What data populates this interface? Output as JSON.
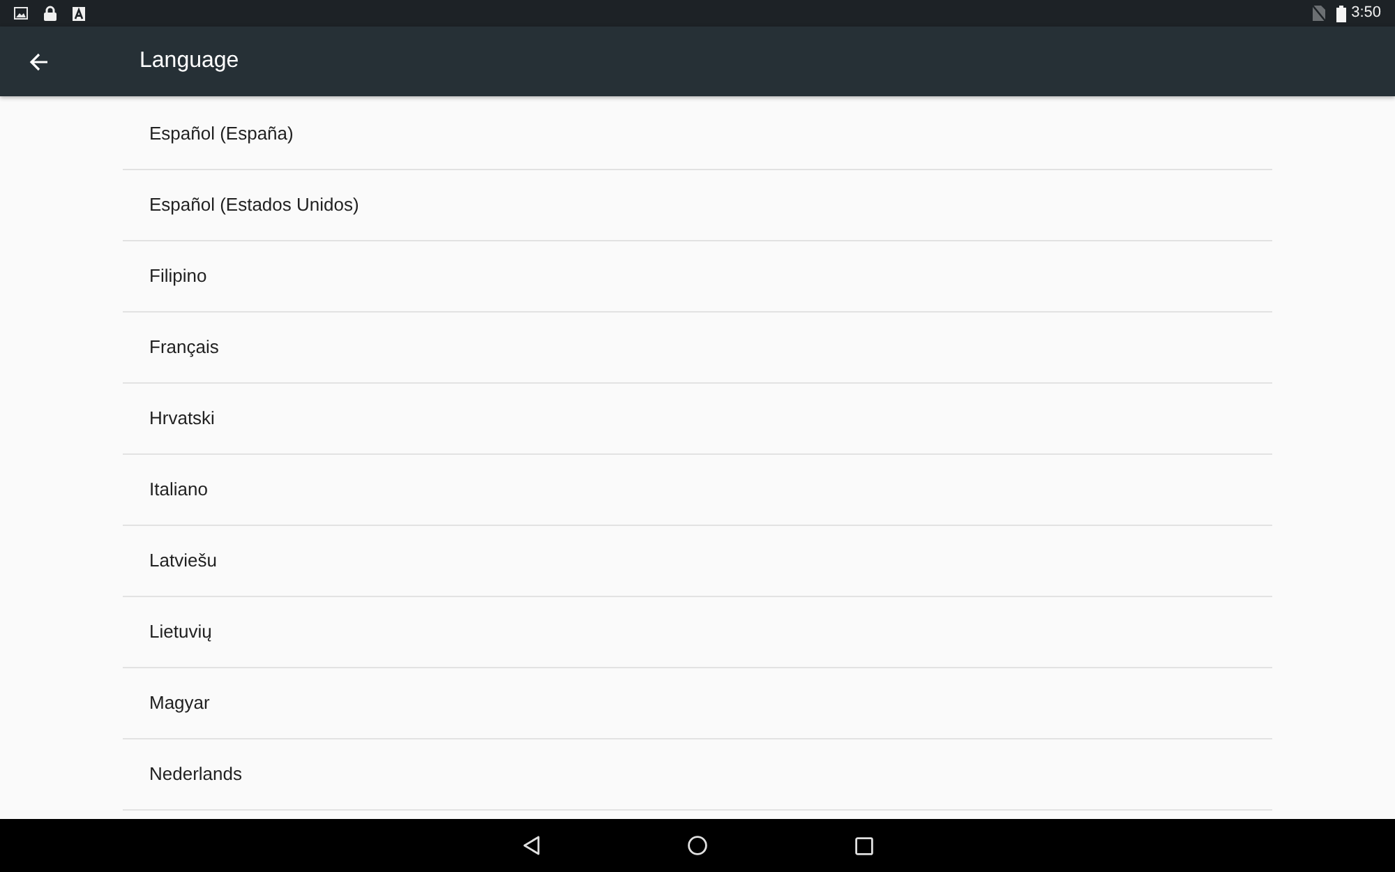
{
  "status_bar": {
    "time": "3:50"
  },
  "toolbar": {
    "title": "Language"
  },
  "languages": [
    {
      "label": "Español (España)"
    },
    {
      "label": "Español (Estados Unidos)"
    },
    {
      "label": "Filipino"
    },
    {
      "label": "Français"
    },
    {
      "label": "Hrvatski"
    },
    {
      "label": "Italiano"
    },
    {
      "label": "Latviešu"
    },
    {
      "label": "Lietuvių"
    },
    {
      "label": "Magyar"
    },
    {
      "label": "Nederlands"
    }
  ]
}
